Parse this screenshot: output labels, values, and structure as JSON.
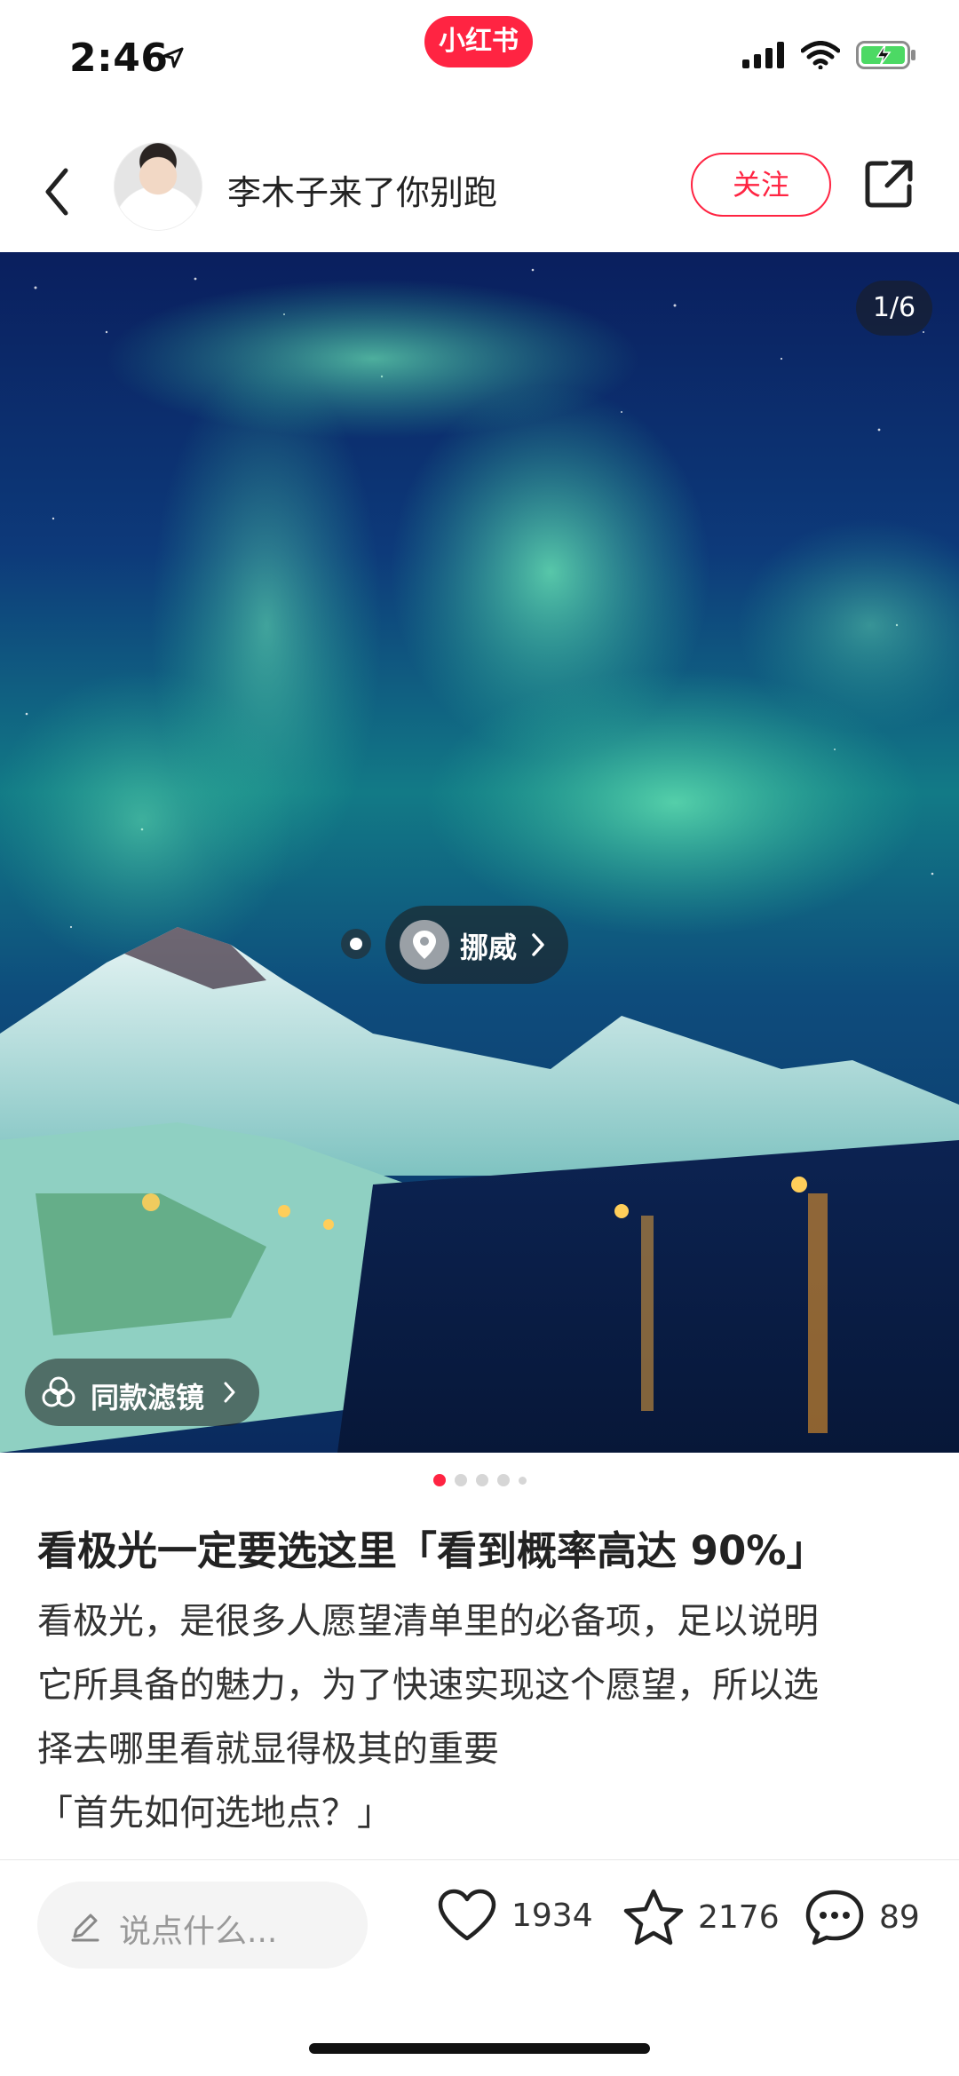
{
  "status_bar": {
    "time": "2:46",
    "app_badge": "小红书"
  },
  "header": {
    "author_name": "李木子来了你别跑",
    "follow_label": "关注"
  },
  "image": {
    "counter": "1/6",
    "location": "挪威",
    "filter_label": "同款滤镜",
    "page_total": 6,
    "page_current": 1
  },
  "note": {
    "title": "看极光一定要选这里「看到概率高达 90%」",
    "body_lines": [
      "看极光，是很多人愿望清单里的必备项，足以说明",
      "它所具备的魅力，为了快速实现这个愿望，所以选",
      "择去哪里看就显得极其的重要",
      "「首先如何选地点？」"
    ]
  },
  "bottom_bar": {
    "comment_placeholder": "说点什么...",
    "likes": "1934",
    "collects": "2176",
    "comments": "89"
  },
  "colors": {
    "accent": "#ff2442"
  },
  "icons": [
    "location-arrow-icon",
    "signal-icon",
    "wifi-icon",
    "battery-charging-icon",
    "back-icon",
    "share-icon",
    "location-pin-icon",
    "chevron-right-icon",
    "filter-icon",
    "pen-icon",
    "heart-icon",
    "star-icon",
    "comment-icon"
  ]
}
